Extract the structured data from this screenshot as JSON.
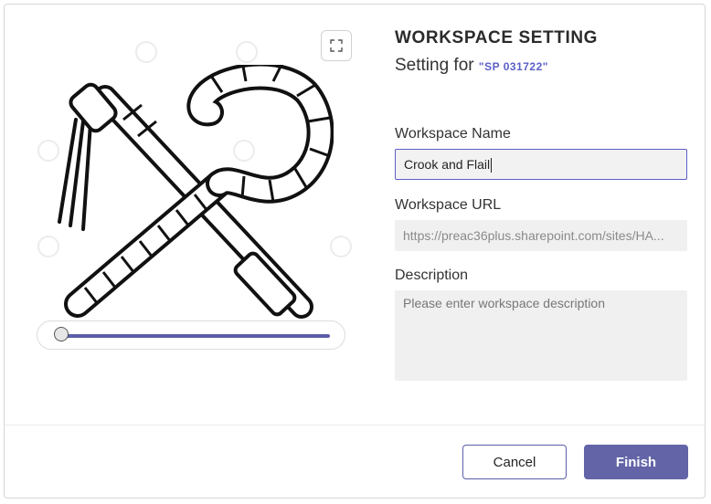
{
  "dialog": {
    "title": "WORKSPACE SETTING",
    "subtitle_prefix": "Setting for ",
    "subtitle_code": "\"SP 031722\"",
    "expand_icon": "expand-icon",
    "artwork_icon": "crook-and-flail-icon",
    "zoom_slider": {
      "value": 0.0
    },
    "fields": {
      "name": {
        "label": "Workspace Name",
        "value": "Crook and Flail"
      },
      "url": {
        "label": "Workspace URL",
        "value": "https://preac36plus.sharepoint.com/sites/HA..."
      },
      "description": {
        "label": "Description",
        "placeholder": "Please enter workspace description"
      }
    },
    "buttons": {
      "cancel": "Cancel",
      "finish": "Finish"
    }
  },
  "colors": {
    "accent": "#6264a7",
    "focus_border": "#5b5fc7",
    "field_bg": "#f0f0f0"
  }
}
